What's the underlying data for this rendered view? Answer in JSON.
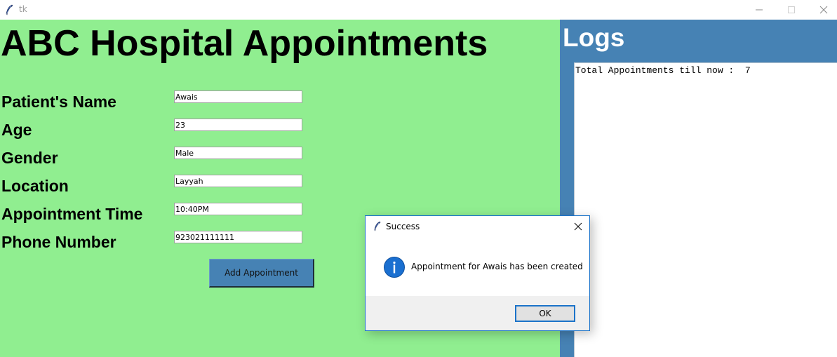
{
  "window": {
    "title": "tk",
    "icon": "tk-feather-icon",
    "controls": [
      "minimize-icon",
      "maximize-icon",
      "close-icon"
    ]
  },
  "main": {
    "title": "ABC Hospital Appointments",
    "background_color": "#90ee90",
    "fields": [
      {
        "label": "Patient's Name",
        "value": "Awais"
      },
      {
        "label": "Age",
        "value": "23"
      },
      {
        "label": "Gender",
        "value": "Male"
      },
      {
        "label": "Location",
        "value": "Layyah"
      },
      {
        "label": "Appointment Time",
        "value": "10:40PM"
      },
      {
        "label": "Phone Number",
        "value": "923021111111"
      }
    ],
    "add_button_label": "Add Appointment",
    "add_button_color": "#4682b4"
  },
  "logs": {
    "title": "Logs",
    "panel_color": "#4682b4",
    "text": "Total Appointments till now :  7"
  },
  "dialog": {
    "title": "Success",
    "icon": "info-icon",
    "message": "Appointment for Awais has been created",
    "ok_label": "OK",
    "accent_color": "#1b73c9"
  }
}
